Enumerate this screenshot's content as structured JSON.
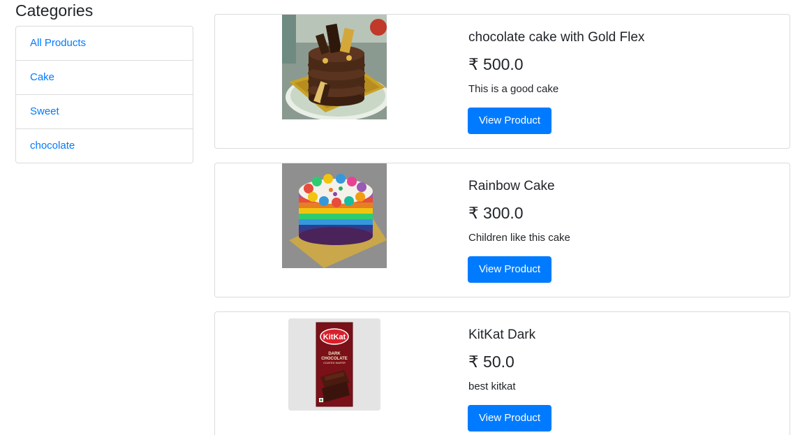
{
  "sidebar": {
    "title": "Categories",
    "items": [
      {
        "label": "All Products"
      },
      {
        "label": "Cake"
      },
      {
        "label": "Sweet"
      },
      {
        "label": "chocolate"
      }
    ]
  },
  "products": [
    {
      "name": "chocolate cake with Gold Flex",
      "price": "₹ 500.0",
      "description": "This is a good cake",
      "button_label": "View Product",
      "image": "chocolate-cake-photo"
    },
    {
      "name": "Rainbow Cake",
      "price": "₹ 300.0",
      "description": "Children like this cake",
      "button_label": "View Product",
      "image": "rainbow-cake-photo"
    },
    {
      "name": "KitKat Dark",
      "price": "₹ 50.0",
      "description": "best kitkat",
      "button_label": "View Product",
      "image": "kitkat-dark-photo",
      "image_text": {
        "brand": "KitKat",
        "line1": "DARK",
        "line2": "CHOCOLATE",
        "line3": "COATED WAFER"
      }
    }
  ],
  "colors": {
    "accent": "#007bff",
    "text": "#212529",
    "border": "#dee2e6"
  }
}
